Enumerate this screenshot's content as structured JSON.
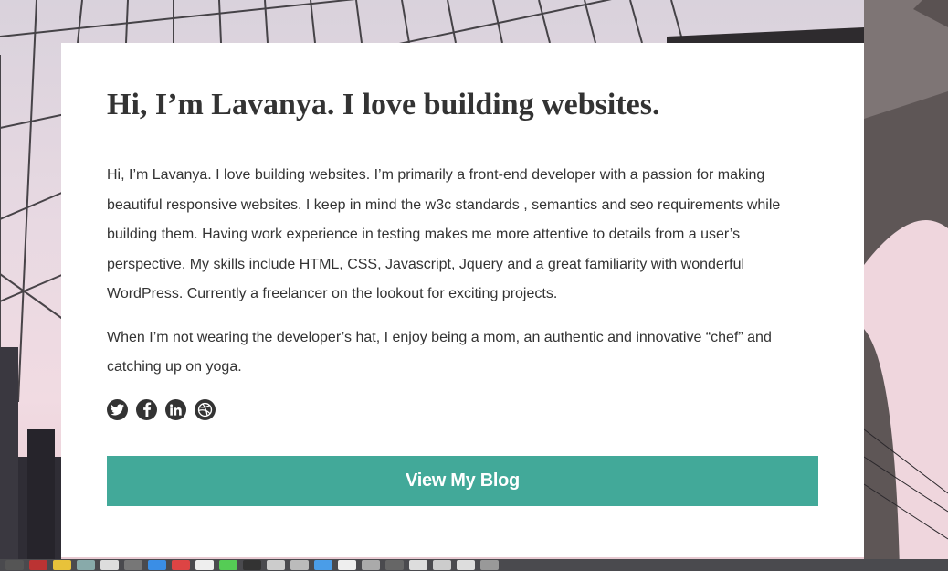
{
  "about": {
    "heading": "Hi, I’m Lavanya. I love building websites.",
    "paragraph1": "Hi, I’m Lavanya. I love building websites. I’m primarily a front-end developer with a passion for making beautiful responsive websites. I keep in mind the w3c standards , semantics and seo requirements while building them. Having work experience in testing makes me more attentive to details from a user’s perspective. My skills include HTML, CSS, Javascript, Jquery and a great familiarity with wonderful WordPress. Currently a freelancer on the lookout for exciting projects.",
    "paragraph2": "When I’m not wearing the developer’s hat, I enjoy being a mom, an authentic and innovative “chef” and catching up on yoga.",
    "social_icons": [
      "twitter-icon",
      "facebook-icon",
      "linkedin-icon",
      "dribbble-icon"
    ],
    "blog_button_label": "View My Blog",
    "accent_color": "#42a999"
  }
}
